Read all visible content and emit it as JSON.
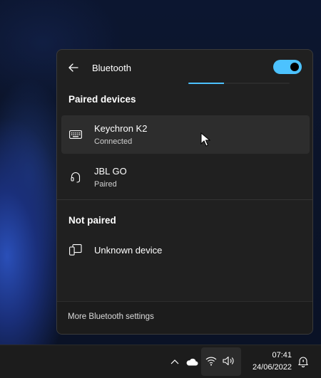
{
  "flyout": {
    "title": "Bluetooth",
    "toggle_on": true,
    "accent_color": "#4cc2ff",
    "progress_fraction": 0.35,
    "paired_section": "Paired devices",
    "not_paired_section": "Not paired",
    "paired_devices": [
      {
        "name": "Keychron K2",
        "status": "Connected",
        "icon": "keyboard-icon"
      },
      {
        "name": "JBL GO",
        "status": "Paired",
        "icon": "headset-icon"
      }
    ],
    "unpaired_devices": [
      {
        "name": "Unknown device",
        "icon": "phone-device-icon"
      }
    ],
    "footer_link": "More Bluetooth settings"
  },
  "taskbar": {
    "time": "07:41",
    "date": "24/06/2022",
    "tray_icons": [
      "chevron-up-icon",
      "cloud-icon",
      "wifi-icon",
      "volume-icon",
      "notification-bell-icon"
    ]
  }
}
